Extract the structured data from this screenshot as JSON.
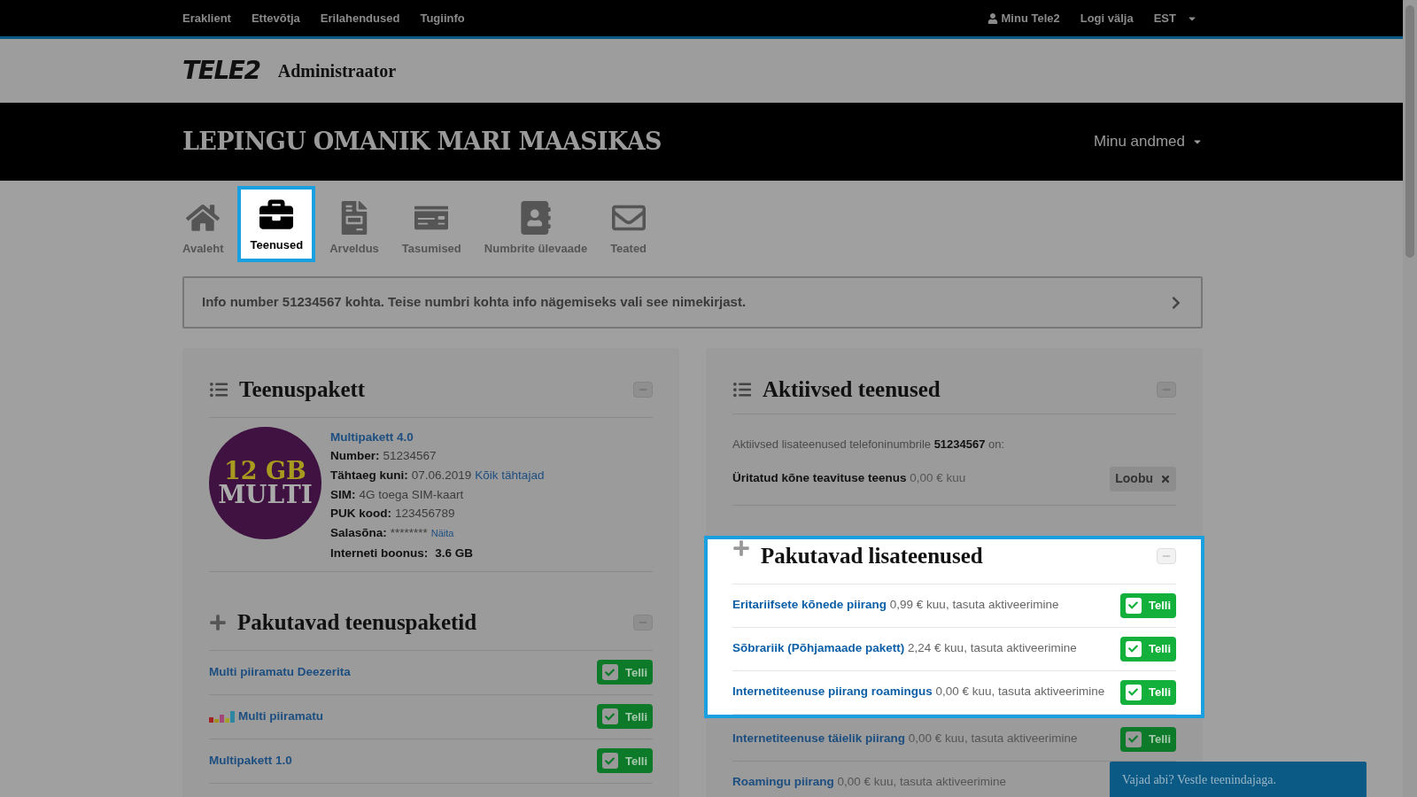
{
  "top_nav": {
    "links": [
      "Eraklient",
      "Ettevõtja",
      "Erilahendused",
      "Tugiinfo"
    ],
    "user": "Minu Tele2",
    "logout": "Logi välja",
    "language": "EST"
  },
  "header": {
    "logo": "TELE2",
    "title": "Administraator"
  },
  "banner": {
    "title": "LEPINGU OMANIK MARI MAASIKAS",
    "menu": "Minu andmed"
  },
  "tabs": [
    {
      "label": "Avaleht",
      "selected": false
    },
    {
      "label": "Teenused",
      "selected": true
    },
    {
      "label": "Arveldus",
      "selected": false
    },
    {
      "label": "Tasumised",
      "selected": false
    },
    {
      "label": "Numbrite ülevaade",
      "selected": false
    },
    {
      "label": "Teated",
      "selected": false
    }
  ],
  "info_bar": {
    "text": "Info number 51234567 kohta. Teise numbri kohta info nägemiseks vali see nimekirjast."
  },
  "package": {
    "title": "Teenuspakett",
    "badge": [
      "12 GB",
      "MULTI"
    ],
    "name": "Multipakett 4.0",
    "fields": [
      {
        "label": "Number:",
        "value": "51234567",
        "kind": "plain"
      },
      {
        "label": "Tähtaeg kuni:",
        "value": "07.06.2019",
        "link": "Kõik tähtajad",
        "kind": "plain"
      },
      {
        "label": "SIM:",
        "value": "4G toega SIM-kaart",
        "kind": "plain"
      },
      {
        "label": "PUK kood:",
        "value": "123456789",
        "kind": "plain"
      },
      {
        "label": "Salasõna:",
        "value": "********",
        "link": "Näita",
        "kind": "plain"
      },
      {
        "label": "Interneti boonus:",
        "value": "3.6 GB",
        "kind": "bold"
      }
    ]
  },
  "offered_packages": {
    "title": "Pakutavad teenuspaketid",
    "items": [
      {
        "name": "Multi piiramatu Deezerita",
        "kind": "plain",
        "button": "Telli"
      },
      {
        "name": "Multi piiramatu",
        "kind": "music",
        "button": "Telli"
      },
      {
        "name": "Multipakett 1.0",
        "kind": "plain",
        "button": "Telli"
      }
    ]
  },
  "active_services": {
    "title": "Aktiivsed teenused",
    "intro": "Aktiivsed lisateenused telefoninumbrile **51234567** on:",
    "items": [
      {
        "name": "Üritatud kõne teavituse teenus",
        "price": "0,00 € kuu",
        "action": "Loobu"
      }
    ]
  },
  "addons": {
    "title": "Pakutavad lisateenused",
    "highlighted": true,
    "items": [
      {
        "name": "Eritariifsete kõnede piirang",
        "price": "0,99 € kuu, tasuta aktiveerimine",
        "button": "Telli",
        "highlighted": true
      },
      {
        "name": "Sõbrariik (Põhjamaade pakett)",
        "price": "2,24 € kuu, tasuta aktiveerimine",
        "button": "Telli",
        "highlighted": true
      },
      {
        "name": "Internetiteenuse piirang roamingus",
        "price": "0,00 € kuu, tasuta aktiveerimine",
        "button": "Telli",
        "highlighted": true
      },
      {
        "name": "Internetiteenuse täielik piirang",
        "price": "0,00 € kuu, tasuta aktiveerimine",
        "button": "Telli",
        "highlighted": false
      },
      {
        "name": "Roamingu piirang",
        "price": "0,00 € kuu, tasuta aktiveerimine",
        "highlighted": false
      }
    ]
  },
  "chat": {
    "text": "Vajad abi? Vestle teenindajaga."
  }
}
